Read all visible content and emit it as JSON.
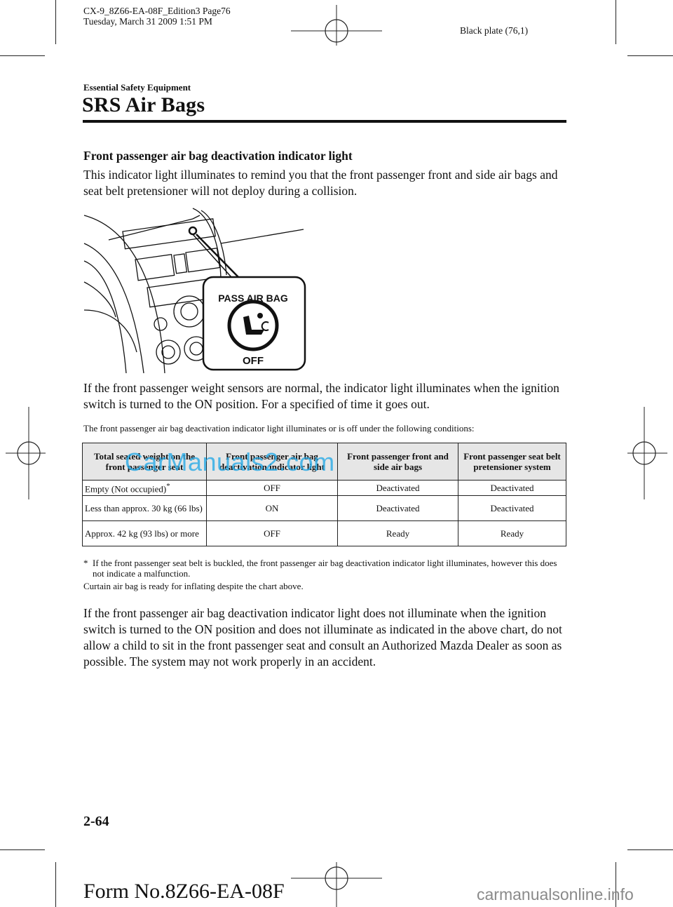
{
  "header": {
    "file_line": "CX-9_8Z66-EA-08F_Edition3 Page76",
    "date_line": "Tuesday, March 31 2009 1:51 PM",
    "plate": "Black plate (76,1)"
  },
  "section": "Essential Safety Equipment",
  "title": "SRS Air Bags",
  "subheading": "Front passenger air bag deactivation indicator light",
  "intro": "This indicator light illuminates to remind you that the front passenger front and side air bags and seat belt pretensioner will not deploy during a collision.",
  "illustration": {
    "icon": "dashboard-indicator-illustration",
    "indicator_top_text": "PASS AIR BAG",
    "indicator_bottom_text": "OFF"
  },
  "para2": "If the front passenger weight sensors are normal, the indicator light illuminates when the ignition switch is turned to the ON position. For a specified of time it goes out.",
  "table_caption": "The front passenger air bag deactivation indicator light illuminates or is off under the following conditions:",
  "table": {
    "headers": [
      "Total seated weight on the front passenger seat",
      "Front passenger air bag deactivation indicator light",
      "Front passenger front and side air bags",
      "Front passenger seat belt pretensioner system"
    ],
    "rows": [
      [
        "Empty (Not occupied)",
        "OFF",
        "Deactivated",
        "Deactivated"
      ],
      [
        "Less than approx. 30 kg (66 lbs)",
        "ON",
        "Deactivated",
        "Deactivated"
      ],
      [
        "Approx. 42 kg (93 lbs) or more",
        "OFF",
        "Ready",
        "Ready"
      ]
    ],
    "row1_marker": "*"
  },
  "footnote_marker": "*",
  "footnote": "If the front passenger seat belt is buckled, the front passenger air bag deactivation indicator light illuminates, however this does not indicate a malfunction.",
  "curtain_note": "Curtain air bag is ready for inflating despite the chart above.",
  "para3": "If the front passenger air bag deactivation indicator light does not illuminate when the ignition switch is turned to the ON position and does not illuminate as indicated in the above chart, do not allow a child to sit in the front passenger seat and consult an Authorized Mazda Dealer as soon as possible. The system may not work properly in an accident.",
  "page_number": "2-64",
  "form_number": "Form No.8Z66-EA-08F",
  "watermarks": {
    "table": "CarManuals2.com",
    "footer": "carmanualsonline.info"
  }
}
